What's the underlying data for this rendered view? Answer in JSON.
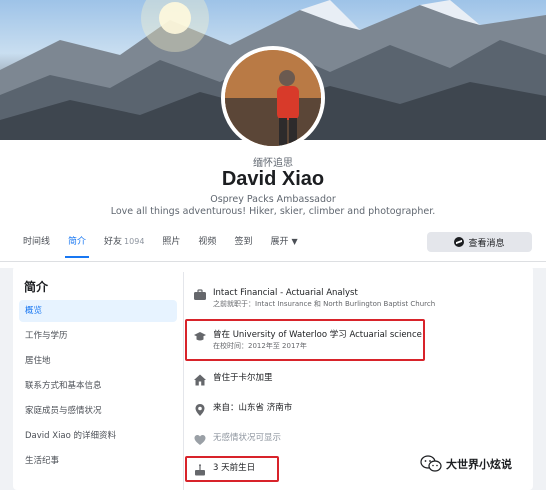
{
  "profile": {
    "memorial_label": "缅怀追思",
    "name": "David Xiao",
    "headline": "Osprey Packs Ambassador",
    "bio": "Love all things adventurous! Hiker, skier, climber and photographer."
  },
  "tabs": [
    {
      "label": "时间线",
      "active": false
    },
    {
      "label": "简介",
      "active": true
    },
    {
      "label": "好友",
      "count": "1094",
      "active": false
    },
    {
      "label": "照片",
      "active": false
    },
    {
      "label": "视频",
      "active": false
    },
    {
      "label": "签到",
      "active": false
    },
    {
      "label": "展开",
      "active": false
    }
  ],
  "message_button": {
    "label": "查看消息",
    "icon": "messenger-icon"
  },
  "about": {
    "title": "简介",
    "sidebar": [
      {
        "label": "概览",
        "active": true
      },
      {
        "label": "工作与学历",
        "active": false
      },
      {
        "label": "居住地",
        "active": false
      },
      {
        "label": "联系方式和基本信息",
        "active": false
      },
      {
        "label": "家庭成员与感情状况",
        "active": false
      },
      {
        "label": "David Xiao 的详细资料",
        "active": false
      },
      {
        "label": "生活纪事",
        "active": false
      }
    ],
    "details": {
      "work": {
        "title": "Intact Financial - Actuarial Analyst",
        "sub": "之前就职于：Intact Insurance 和 North Burlington Baptist Church",
        "icon": "briefcase-icon"
      },
      "education": {
        "title": "曾在 University of Waterloo 学习 Actuarial science",
        "sub": "在校时间：2012年至 2017年",
        "icon": "graduation-cap-icon"
      },
      "lived": {
        "title": "曾住于卡尔加里",
        "icon": "home-icon"
      },
      "from": {
        "title": "来自：山东省 济南市",
        "icon": "location-pin-icon"
      },
      "relationship": {
        "title": "无感情状况可显示",
        "icon": "heart-icon"
      },
      "birthday": {
        "title": "3 天前生日",
        "icon": "cake-icon"
      }
    }
  },
  "watermark": {
    "text": "大世界小炫说",
    "icon": "wechat-icon"
  },
  "colors": {
    "accent": "#1877f2",
    "highlight": "#d8232a"
  }
}
